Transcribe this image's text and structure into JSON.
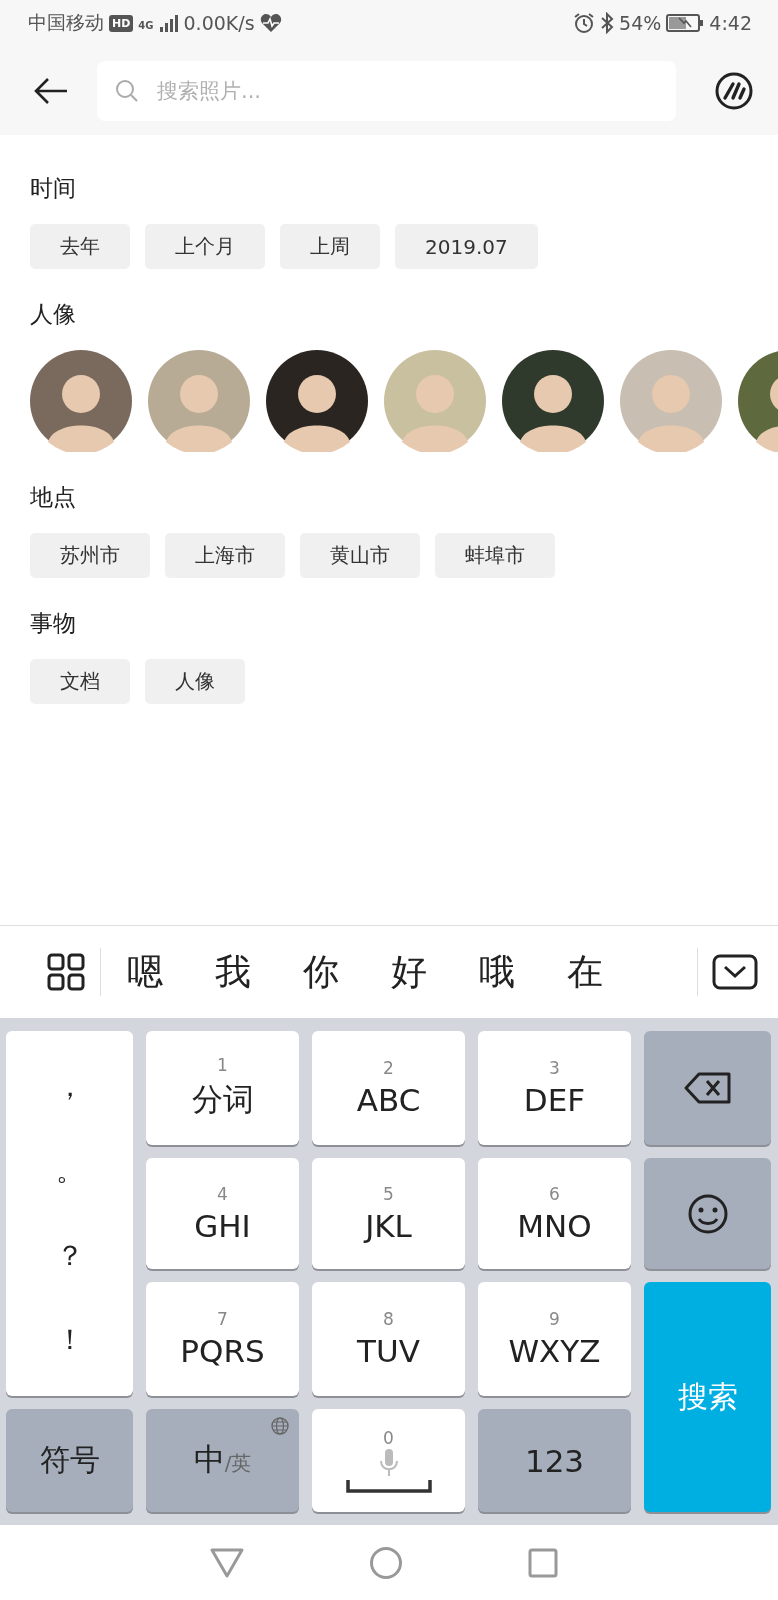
{
  "status_bar": {
    "carrier": "中国移动",
    "hd_badge": "HD",
    "network": "4G",
    "speed": "0.00K/s",
    "battery_percent": "54%",
    "time": "4:42"
  },
  "search": {
    "placeholder": "搜索照片..."
  },
  "sections": [
    {
      "title": "时间",
      "kind": "chips",
      "chips": [
        "去年",
        "上个月",
        "上周",
        "2019.07"
      ]
    },
    {
      "title": "人像",
      "kind": "people",
      "people": [
        {
          "kind": "avatar",
          "color": "#7a6a5e"
        },
        {
          "kind": "avatar",
          "color": "#b8ab96"
        },
        {
          "kind": "avatar",
          "color": "#2b2522"
        },
        {
          "kind": "avatar",
          "color": "#c9c0a0"
        },
        {
          "kind": "avatar",
          "color": "#2f3a2c"
        },
        {
          "kind": "avatar",
          "color": "#c8beb2"
        },
        {
          "kind": "avatar",
          "color": "#5e6a3e"
        }
      ]
    },
    {
      "title": "地点",
      "kind": "chips",
      "chips": [
        "苏州市",
        "上海市",
        "黄山市",
        "蚌埠市"
      ]
    },
    {
      "title": "事物",
      "kind": "chips",
      "chips": [
        "文档",
        "人像"
      ]
    }
  ],
  "candidates": [
    "嗯",
    "我",
    "你",
    "好",
    "哦",
    "在"
  ],
  "keyboard": {
    "punctuation": [
      "，",
      "。",
      "？",
      "！"
    ],
    "keys": [
      {
        "digit": "1",
        "label": "分词"
      },
      {
        "digit": "2",
        "label": "ABC"
      },
      {
        "digit": "3",
        "label": "DEF"
      },
      {
        "digit": "4",
        "label": "GHI"
      },
      {
        "digit": "5",
        "label": "JKL"
      },
      {
        "digit": "6",
        "label": "MNO"
      },
      {
        "digit": "7",
        "label": "PQRS"
      },
      {
        "digit": "8",
        "label": "TUV"
      },
      {
        "digit": "9",
        "label": "WXYZ"
      }
    ],
    "search_key": "搜索",
    "symbols_key": "符号",
    "lang_key": {
      "primary": "中",
      "secondary": "/英"
    },
    "space_key": {
      "digit": "0"
    },
    "numbers_key": "123"
  }
}
